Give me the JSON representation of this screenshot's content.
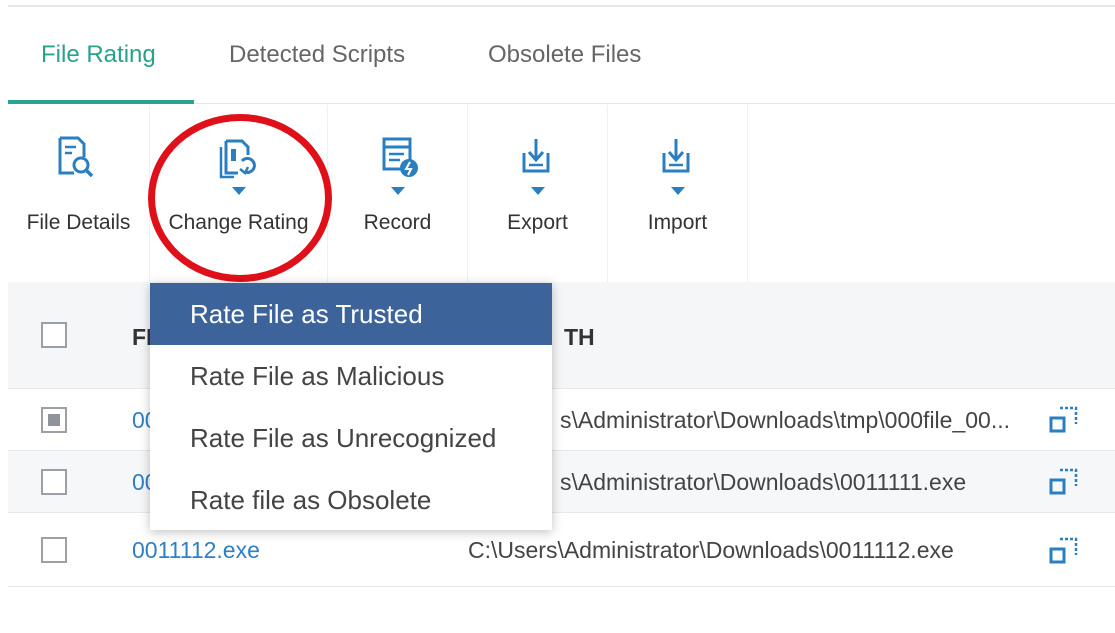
{
  "tabs": [
    {
      "label": "File Rating",
      "active": true
    },
    {
      "label": "Detected Scripts",
      "active": false
    },
    {
      "label": "Obsolete Files",
      "active": false
    }
  ],
  "toolbar": [
    {
      "label": "File Details",
      "icon": "file-search-icon",
      "has_caret": false
    },
    {
      "label": "Change Rating",
      "icon": "file-refresh-icon",
      "has_caret": true
    },
    {
      "label": "Record",
      "icon": "record-icon",
      "has_caret": true
    },
    {
      "label": "Export",
      "icon": "export-icon",
      "has_caret": true
    },
    {
      "label": "Import",
      "icon": "import-icon",
      "has_caret": true
    }
  ],
  "dropdown": {
    "items": [
      {
        "label": "Rate File as Trusted",
        "active": true
      },
      {
        "label": "Rate File as Malicious",
        "active": false
      },
      {
        "label": "Rate File as Unrecognized",
        "active": false
      },
      {
        "label": "Rate file as Obsolete",
        "active": false
      }
    ]
  },
  "table": {
    "headers": {
      "name_partial": "FI",
      "path_partial": "TH"
    },
    "rows": [
      {
        "name": "00",
        "path": "s\\Administrator\\Downloads\\tmp\\000file_00...",
        "checked": true
      },
      {
        "name": "00",
        "path": "s\\Administrator\\Downloads\\0011111.exe",
        "checked": false
      },
      {
        "name": "0011112.exe",
        "path": "C:\\Users\\Administrator\\Downloads\\0011112.exe",
        "checked": false
      }
    ]
  },
  "colors": {
    "accent_tab": "#27a28f",
    "icon_blue": "#2a7fc0",
    "link_blue": "#2f7fc6",
    "dropdown_active": "#3c649a",
    "annotation_red": "#e0101a"
  }
}
